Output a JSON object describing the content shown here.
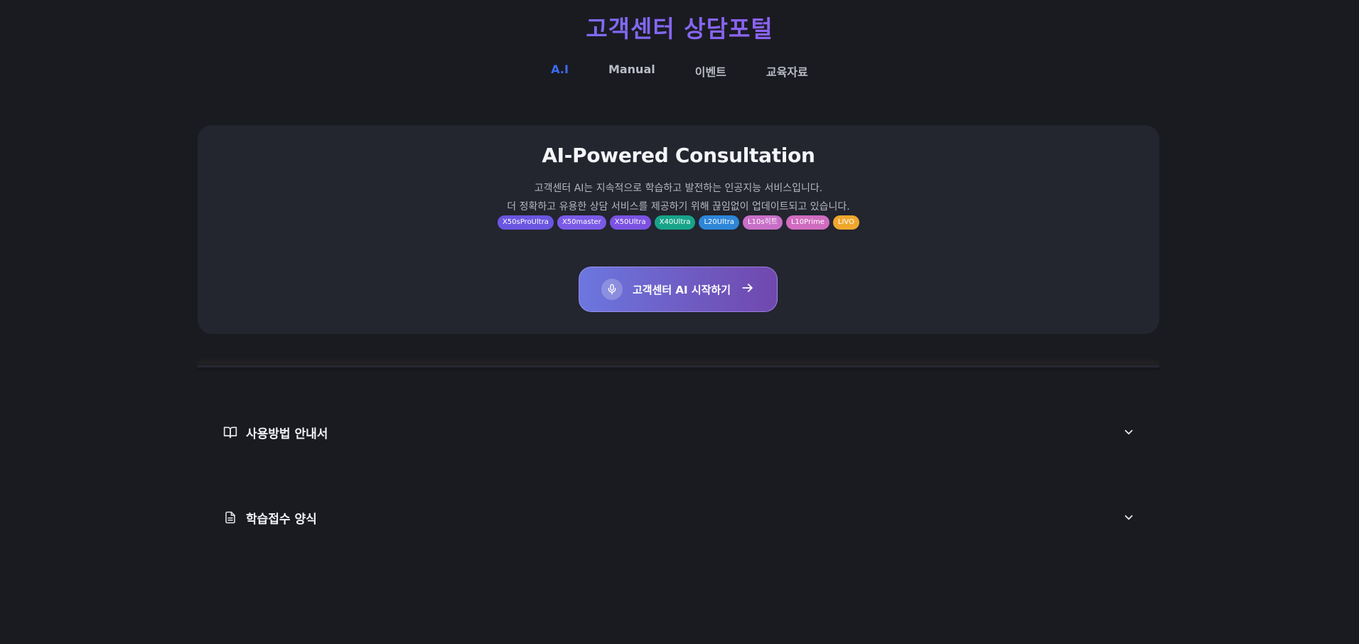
{
  "header": {
    "title": "고객센터 상담포털"
  },
  "nav": {
    "items": [
      {
        "label": "A.I",
        "active": true
      },
      {
        "label": "Manual",
        "active": false
      },
      {
        "label": "이벤트",
        "active": false
      },
      {
        "label": "교육자료",
        "active": false
      }
    ]
  },
  "hero": {
    "title": "AI-Powered Consultation",
    "description_line1": "고객센터 AI는 지속적으로 학습하고 발전하는 인공지능 서비스입니다.",
    "description_line2": "더 정확하고 유용한 상담 서비스를 제공하기 위해 끊임없이 업데이트되고 있습니다.",
    "badges": [
      {
        "label": "X50sProUltra",
        "color": "#6a56e0"
      },
      {
        "label": "X50master",
        "color": "#7a5ae6"
      },
      {
        "label": "X50Ultra",
        "color": "#7b52e2"
      },
      {
        "label": "X40Ultra",
        "color": "#17a48a"
      },
      {
        "label": "L20Ultra",
        "color": "#2e86d8"
      },
      {
        "label": "L10s히트",
        "color": "#c86fc8"
      },
      {
        "label": "L10Prime",
        "color": "#d06cc0"
      },
      {
        "label": "LIVO",
        "color": "#efa72d"
      }
    ],
    "start_button": {
      "label": "고객센터 AI 시작하기",
      "icon": "microphone-icon",
      "trailing_icon": "arrow-right-icon"
    }
  },
  "accordion": {
    "items": [
      {
        "label": "사용방법 안내서",
        "icon": "book-open-icon"
      },
      {
        "label": "학습접수 양식",
        "icon": "document-icon"
      }
    ]
  },
  "colors": {
    "background": "#1a1b21",
    "card": "#23252f",
    "accent": "#3d6cf4"
  }
}
